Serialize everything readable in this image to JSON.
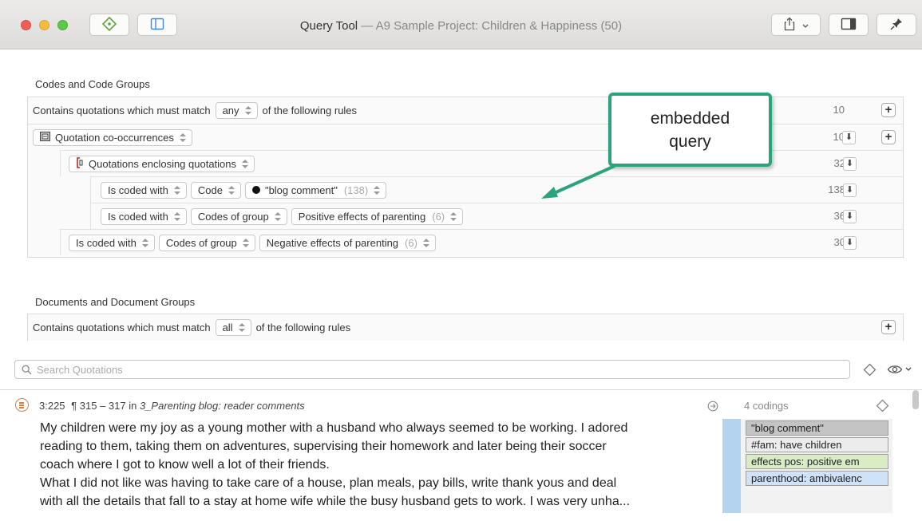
{
  "window": {
    "title": "Query Tool",
    "subtitle": " — A9 Sample Project: Children & Happiness (50)"
  },
  "codes_section": {
    "label": "Codes and Code Groups",
    "root": {
      "prefix": "Contains quotations which must match",
      "operator": "any",
      "suffix": "of the following rules",
      "count": "10"
    },
    "rows": [
      {
        "name": "Quotation co-occurrences",
        "count": "10"
      },
      {
        "name": "Quotations enclosing quotations",
        "count": "32"
      },
      {
        "relation": "Is coded with",
        "scope": "Code",
        "value": "\"blog comment\"",
        "value_count": "(138)",
        "count": "138"
      },
      {
        "relation": "Is coded with",
        "scope": "Codes of group",
        "value": "Positive effects of parenting",
        "value_count": "(6)",
        "count": "36"
      },
      {
        "relation": "Is coded with",
        "scope": "Codes of group",
        "value": "Negative effects of parenting",
        "value_count": "(6)",
        "count": "30"
      }
    ]
  },
  "documents_section": {
    "label": "Documents and Document Groups",
    "root": {
      "prefix": "Contains quotations which must match",
      "operator": "all",
      "suffix": "of the following rules"
    }
  },
  "callout": {
    "line1": "embedded",
    "line2": "query"
  },
  "search": {
    "placeholder": "Search Quotations"
  },
  "quotation": {
    "id": "3:225",
    "range": "¶ 315 – 317 in",
    "document": "3_Parenting blog: reader comments",
    "lines": [
      "My children were my joy as a young mother with a husband who always seemed to be working. I adored",
      "reading to them, taking them on adventures, supervising their homework and later being their soccer",
      "coach where I got to know well a lot of their friends.",
      "What I did not like was having to take care of a house, plan meals, pay bills, write thank yous and deal",
      "with all the details that fall to a stay at home wife while the busy husband gets to work. I was very unha..."
    ],
    "codings_label": "4 codings",
    "codings": [
      {
        "label": "\"blog comment\"",
        "color": "#c4c4c4"
      },
      {
        "label": "#fam: have children",
        "color": "#ececec"
      },
      {
        "label": "effects pos: positive em",
        "color": "#d9ecc5"
      },
      {
        "label": "parenthood: ambivalenc",
        "color": "#cfe2f7"
      }
    ]
  },
  "colors": {
    "callout_border": "#2aa37f",
    "quotation_icon": "#e07d3c",
    "coding_bar": "#b3d3ee"
  }
}
